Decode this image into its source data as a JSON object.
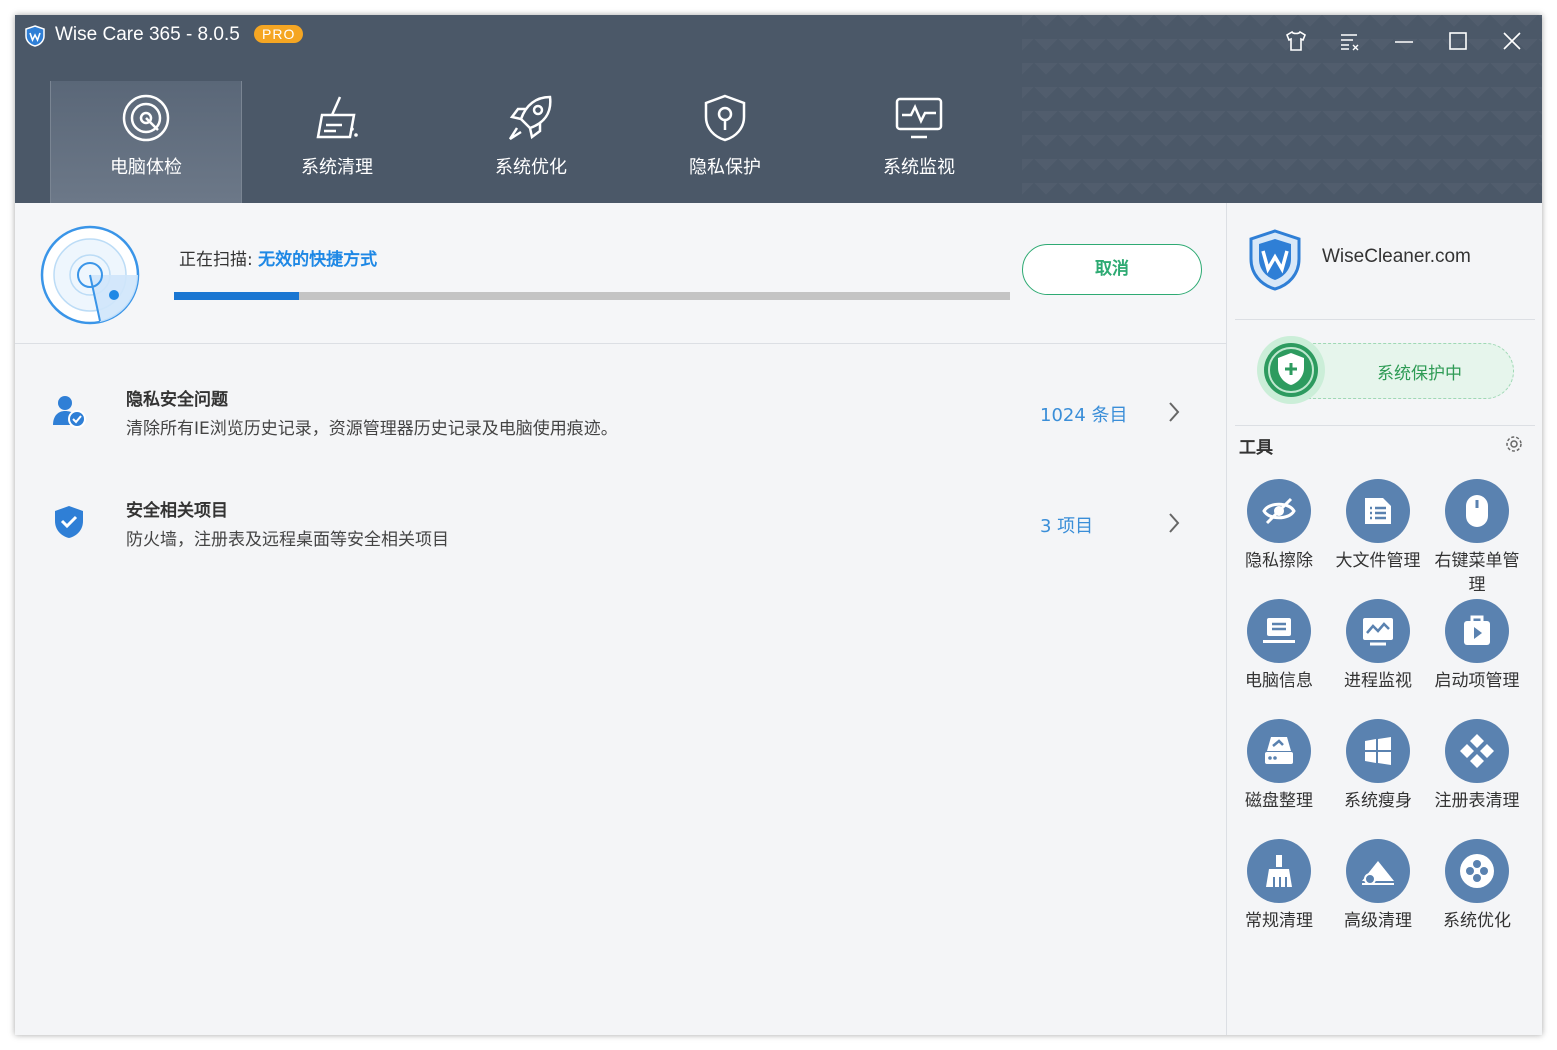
{
  "app": {
    "title": "Wise Care 365 - 8.0.5",
    "badge": "PRO"
  },
  "tabs": [
    {
      "label": "电脑体检",
      "icon": "radar-icon",
      "active": true
    },
    {
      "label": "系统清理",
      "icon": "broom-clean-icon"
    },
    {
      "label": "系统优化",
      "icon": "rocket-icon"
    },
    {
      "label": "隐私保护",
      "icon": "privacy-shield-icon"
    },
    {
      "label": "系统监视",
      "icon": "monitor-pulse-icon"
    }
  ],
  "scan": {
    "prefix": "正在扫描: ",
    "target": "无效的快捷方式",
    "progress_pct": 15,
    "cancel_label": "取消"
  },
  "issues": [
    {
      "title": "隐私安全问题",
      "desc": "清除所有IE浏览历史记录，资源管理器历史记录及电脑使用痕迹。",
      "count": "1024 条目",
      "icon": "user-shield-icon"
    },
    {
      "title": "安全相关项目",
      "desc": "防火墙，注册表及远程桌面等安全相关项目",
      "count": "3 项目",
      "icon": "shield-check-icon"
    }
  ],
  "sidebar": {
    "brand": "WiseCleaner.com",
    "protect_label": "系统保护中",
    "tools_title": "工具",
    "tools": [
      {
        "label": "隐私擦除",
        "icon": "eye-off-icon"
      },
      {
        "label": "大文件管理",
        "icon": "file-list-icon"
      },
      {
        "label": "右键菜单管理",
        "icon": "mouse-icon"
      },
      {
        "label": "电脑信息",
        "icon": "laptop-icon"
      },
      {
        "label": "进程监视",
        "icon": "process-monitor-icon"
      },
      {
        "label": "启动项管理",
        "icon": "startup-icon"
      },
      {
        "label": "磁盘整理",
        "icon": "disk-icon"
      },
      {
        "label": "系统瘦身",
        "icon": "windows-icon"
      },
      {
        "label": "注册表清理",
        "icon": "registry-icon"
      },
      {
        "label": "常规清理",
        "icon": "brush-icon"
      },
      {
        "label": "高级清理",
        "icon": "eraser-icon"
      },
      {
        "label": "系统优化",
        "icon": "fan-icon"
      }
    ]
  },
  "colors": {
    "header": "#4b5868",
    "accent": "#1976d2",
    "green": "#2eaa73",
    "tool_circle": "#5a82b0",
    "pro": "#f5a623"
  }
}
